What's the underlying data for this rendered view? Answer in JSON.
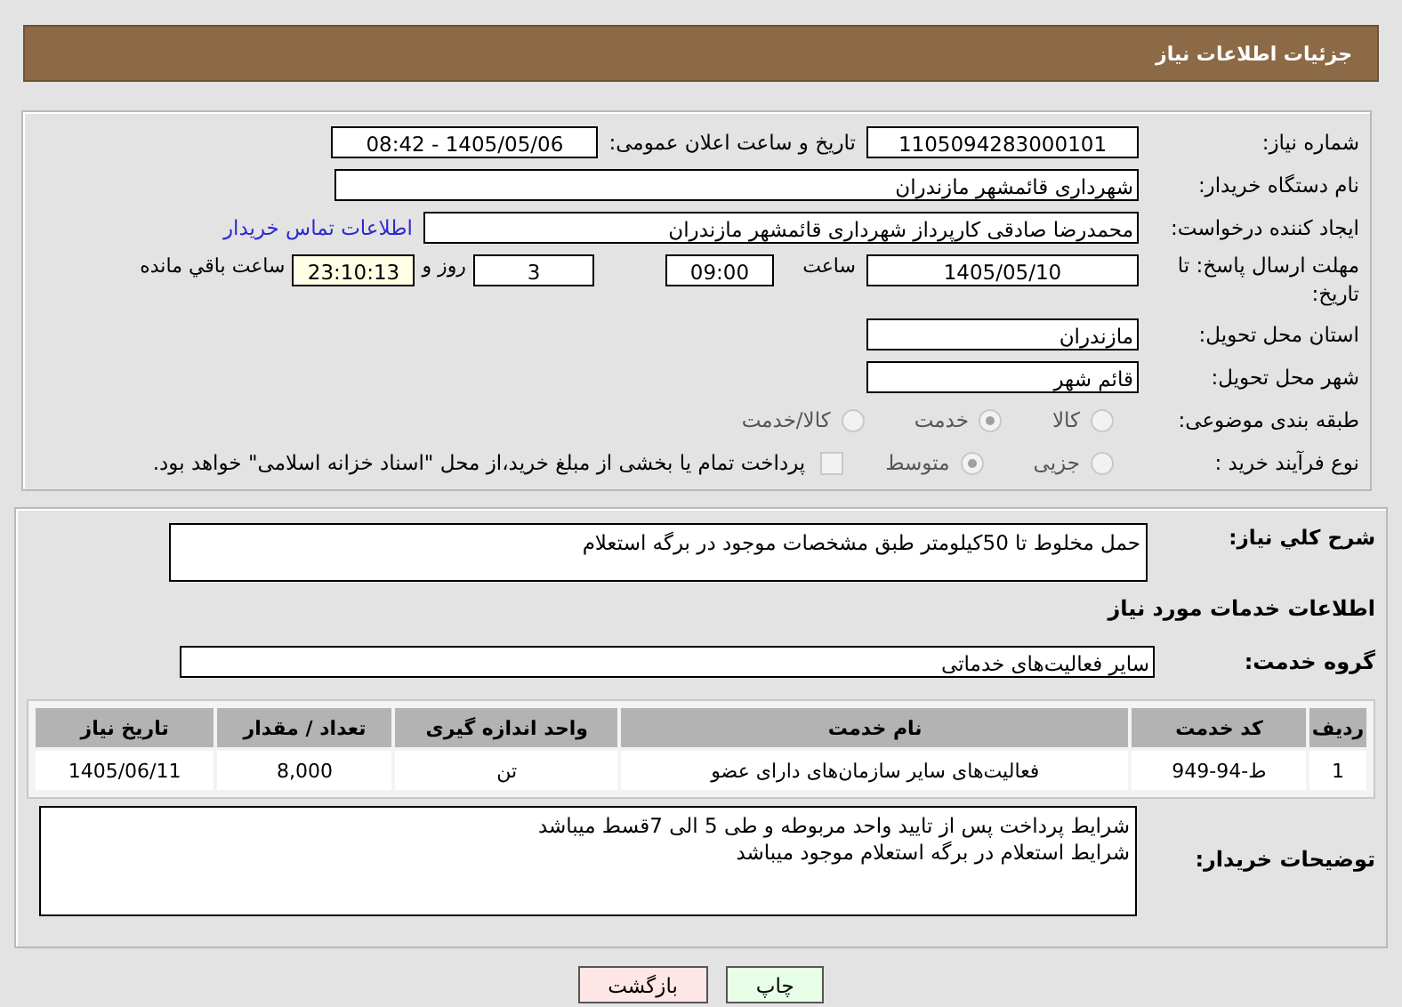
{
  "header": {
    "title": "جزئیات اطلاعات نیاز"
  },
  "need_number": {
    "label": "شماره نیاز:",
    "value": "1105094283000101"
  },
  "announce": {
    "label": "تاریخ و ساعت اعلان عمومی:",
    "value": "1405/05/06 - 08:42"
  },
  "buyer": {
    "label": "نام دستگاه خریدار:",
    "value": "شهرداری قائمشهر مازندران"
  },
  "requester": {
    "label": "ایجاد کننده درخواست:",
    "value": "محمدرضا صادقی کارپرداز شهرداری قائمشهر مازندران",
    "contact_link": "اطلاعات تماس خریدار"
  },
  "deadline": {
    "label": "مهلت ارسال پاسخ: تا تاریخ:",
    "date": "1405/05/10",
    "time_label": "ساعت",
    "time": "09:00",
    "days": "3",
    "days_label": "روز و",
    "remaining": "23:10:13",
    "remaining_label": "ساعت باقي مانده"
  },
  "province": {
    "label": "استان محل تحویل:",
    "value": "مازندران"
  },
  "city": {
    "label": "شهر محل تحویل:",
    "value": "قائم شهر"
  },
  "category": {
    "label": "طبقه بندی موضوعی:",
    "options": [
      {
        "label": "کالا",
        "selected": false
      },
      {
        "label": "خدمت",
        "selected": true
      },
      {
        "label": "کالا/خدمت",
        "selected": false
      }
    ]
  },
  "process": {
    "label": "نوع فرآیند خرید :",
    "options": [
      {
        "label": "جزیی",
        "selected": false
      },
      {
        "label": "متوسط",
        "selected": true
      }
    ],
    "payment": {
      "label": "پرداخت تمام یا بخشی از مبلغ خرید،از محل \"اسناد خزانه اسلامی\" خواهد بود.",
      "checked": false
    }
  },
  "summary": {
    "label": "شرح کلي نیاز:",
    "value": "حمل مخلوط تا 50کیلومتر طبق مشخصات موجود در برگه استعلام"
  },
  "services_heading": "اطلاعات خدمات مورد نیاز",
  "service_group": {
    "label": "گروه خدمت:",
    "value": "سایر فعالیت‌های خدماتی"
  },
  "table": {
    "columns": [
      "ردیف",
      "کد خدمت",
      "نام خدمت",
      "واحد اندازه گیری",
      "تعداد / مقدار",
      "تاریخ نیاز"
    ],
    "rows": [
      [
        "1",
        "ط-94-949",
        "فعالیت‌های سایر سازمان‌های دارای عضو",
        "تن",
        "8,000",
        "1405/06/11"
      ]
    ]
  },
  "buyer_notes": {
    "label": "توضیحات خریدار:",
    "lines": [
      "شرایط پرداخت پس از تایید واحد مربوطه و طی 5 الی 7قسط میباشد",
      "شرایط استعلام در برگه استعلام موجود میباشد"
    ]
  },
  "buttons": [
    {
      "label": "چاپ",
      "kind": "print"
    },
    {
      "label": "بازگشت",
      "kind": "back"
    }
  ]
}
